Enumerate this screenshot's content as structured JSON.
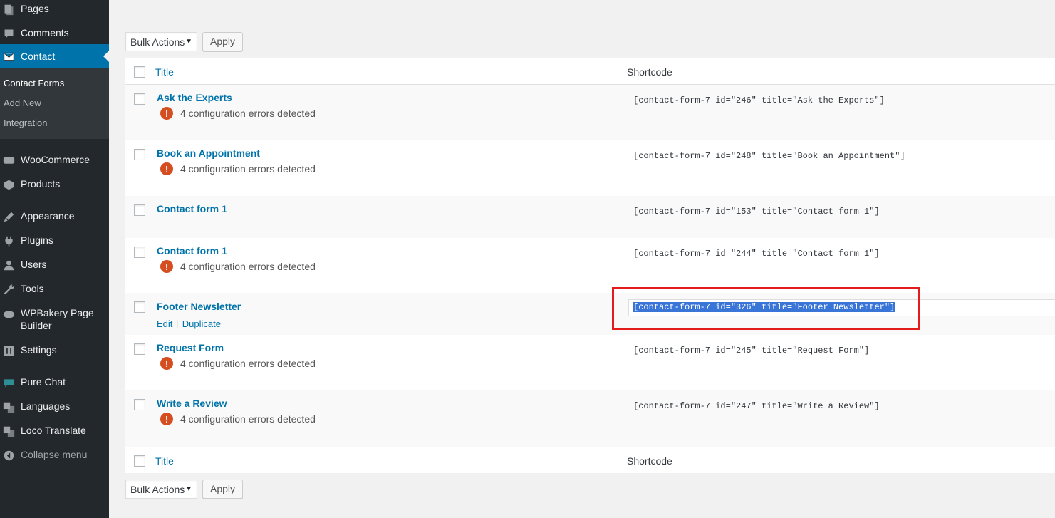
{
  "sidebar": {
    "items": [
      {
        "label": "Pages",
        "icon": "pages-icon"
      },
      {
        "label": "Comments",
        "icon": "comments-icon"
      },
      {
        "label": "Contact",
        "icon": "mail-icon"
      },
      {
        "label": "WooCommerce",
        "icon": "woocommerce-icon"
      },
      {
        "label": "Products",
        "icon": "products-icon"
      },
      {
        "label": "Appearance",
        "icon": "appearance-icon"
      },
      {
        "label": "Plugins",
        "icon": "plugins-icon"
      },
      {
        "label": "Users",
        "icon": "users-icon"
      },
      {
        "label": "Tools",
        "icon": "tools-icon"
      },
      {
        "label": "WPBakery Page Builder",
        "icon": "wpbakery-icon"
      },
      {
        "label": "Settings",
        "icon": "settings-icon"
      },
      {
        "label": "Pure Chat",
        "icon": "chat-icon"
      },
      {
        "label": "Languages",
        "icon": "languages-icon"
      },
      {
        "label": "Loco Translate",
        "icon": "translate-icon"
      },
      {
        "label": "Collapse menu",
        "icon": "collapse-icon"
      }
    ],
    "submenu": [
      "Contact Forms",
      "Add New",
      "Integration"
    ]
  },
  "bulk": {
    "select_label": "Bulk Actions",
    "apply_label": "Apply"
  },
  "table": {
    "col_title": "Title",
    "col_shortcode": "Shortcode",
    "error_text": "4 configuration errors detected",
    "rows": [
      {
        "title": "Ask the Experts",
        "shortcode": "[contact-form-7 id=\"246\" title=\"Ask the Experts\"]"
      },
      {
        "title": "Book an Appointment",
        "shortcode": "[contact-form-7 id=\"248\" title=\"Book an Appointment\"]"
      },
      {
        "title": "Contact form 1",
        "shortcode": "[contact-form-7 id=\"153\" title=\"Contact form 1\"]"
      },
      {
        "title": "Contact form 1",
        "shortcode": "[contact-form-7 id=\"244\" title=\"Contact form 1\"]"
      },
      {
        "title": "Footer Newsletter",
        "shortcode": "[contact-form-7 id=\"326\" title=\"Footer Newsletter\"]",
        "actions": [
          "Edit",
          "Duplicate"
        ]
      },
      {
        "title": "Request Form",
        "shortcode": "[contact-form-7 id=\"245\" title=\"Request Form\"]"
      },
      {
        "title": "Write a Review",
        "shortcode": "[contact-form-7 id=\"247\" title=\"Write a Review\"]"
      }
    ]
  },
  "colors": {
    "accent": "#0073aa",
    "sidebar_bg": "#23282d",
    "error": "#d54e21",
    "highlight": "#e31b1b"
  }
}
